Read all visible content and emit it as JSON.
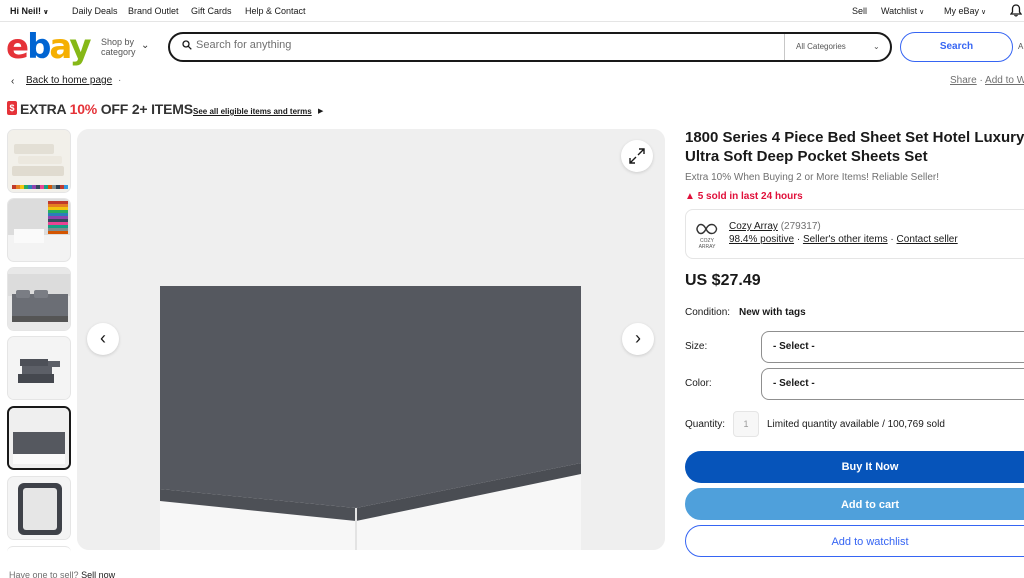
{
  "topbar": {
    "greeting": "Hi Neil!",
    "links": [
      "Daily Deals",
      "Brand Outlet",
      "Gift Cards",
      "Help & Contact"
    ],
    "sell": "Sell",
    "watchlist": "Watchlist",
    "myebay": "My eBay"
  },
  "header": {
    "logo": {
      "e": "e",
      "b": "b",
      "a": "a",
      "y": "y"
    },
    "shop_by": "Shop by",
    "shop_by_2": "category",
    "search_placeholder": "Search for anything",
    "category_select": "All Categories",
    "search_button": "Search",
    "advanced": "A"
  },
  "breadcrumb": {
    "back": "Back to home page",
    "share": "Share",
    "add_to": "Add to W"
  },
  "promo": {
    "badge": "$",
    "prefix": "EXTRA ",
    "percent": "10%",
    "suffix": " OFF 2+ ITEMS",
    "link": "See all eligible items and terms"
  },
  "gallery": {
    "below_text": "Have one to sell?",
    "sell_now": "Sell now"
  },
  "listing": {
    "title": "1800 Series 4 Piece Bed Sheet Set Hotel Luxury Ultra Soft Deep Pocket Sheets Set",
    "subtitle": "Extra 10% When Buying 2 or More Items! Reliable Seller!",
    "sold": "5 sold in last 24 hours",
    "seller": {
      "logo_text": "COZY ARRAY",
      "name": "Cozy Array",
      "count": "(279317)",
      "positive": "98.4% positive",
      "other_items": "Seller's other items",
      "contact": "Contact seller"
    },
    "price": "US $27.49",
    "condition_label": "Condition:",
    "condition_value": "New with tags",
    "size_label": "Size:",
    "size_value": "- Select -",
    "color_label": "Color:",
    "color_value": "- Select -",
    "quantity_label": "Quantity:",
    "quantity_value": "1",
    "quantity_avail": "Limited quantity available / 100,769 sold",
    "buy_now": "Buy It Now",
    "add_to_cart": "Add to cart",
    "add_to_watchlist": "Add to watchlist"
  },
  "colors": {
    "brand_blue": "#3665f3",
    "buy_blue": "#0654ba",
    "cart_blue": "#4fa0db",
    "alert_red": "#e0103a"
  }
}
